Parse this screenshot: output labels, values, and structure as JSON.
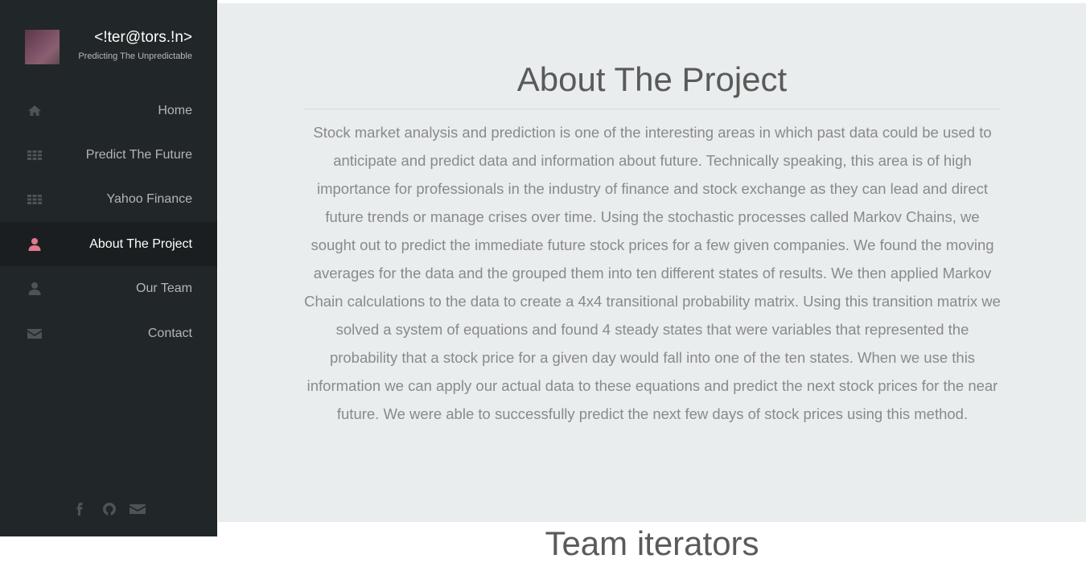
{
  "brand": {
    "title": "<!ter@tors.!n>",
    "subtitle": "Predicting The Unpredictable"
  },
  "nav": {
    "items": [
      {
        "label": "Home",
        "icon": "home-icon"
      },
      {
        "label": "Predict The Future",
        "icon": "grid-icon"
      },
      {
        "label": "Yahoo Finance",
        "icon": "grid-icon"
      },
      {
        "label": "About The Project",
        "icon": "user-icon",
        "active": true
      },
      {
        "label": "Our Team",
        "icon": "user-icon"
      },
      {
        "label": "Contact",
        "icon": "envelope-icon"
      }
    ]
  },
  "social": [
    "facebook-icon",
    "github-icon",
    "envelope-icon"
  ],
  "about": {
    "title": "About The Project",
    "body": "Stock market analysis and prediction is one of the interesting areas in which past data could be used to anticipate and predict data and information about future. Technically speaking, this area is of high importance for professionals in the industry of finance and stock exchange as they can lead and direct future trends or manage crises over time. Using the stochastic processes called Markov Chains, we sought out to predict the immediate future stock prices for a few given companies. We found the moving averages for the data and the grouped them into ten different states of results. We then applied Markov Chain calculations to the data to create a 4x4 transitional probability matrix. Using this transition matrix we solved a system of equations and found 4 steady states that were variables that represented the probability that a stock price for a given day would fall into one of the ten states. When we use this information we can apply our actual data to these equations and predict the next stock prices for the near future. We were able to successfully predict the next few days of stock prices using this method."
  },
  "next_section": {
    "title": "Team iterators"
  },
  "colors": {
    "sidebar_bg": "#212629",
    "active_bg": "#1a1e20",
    "active_icon": "#e07a8c",
    "icon": "#4c5458",
    "content_bg": "#e9eded"
  }
}
